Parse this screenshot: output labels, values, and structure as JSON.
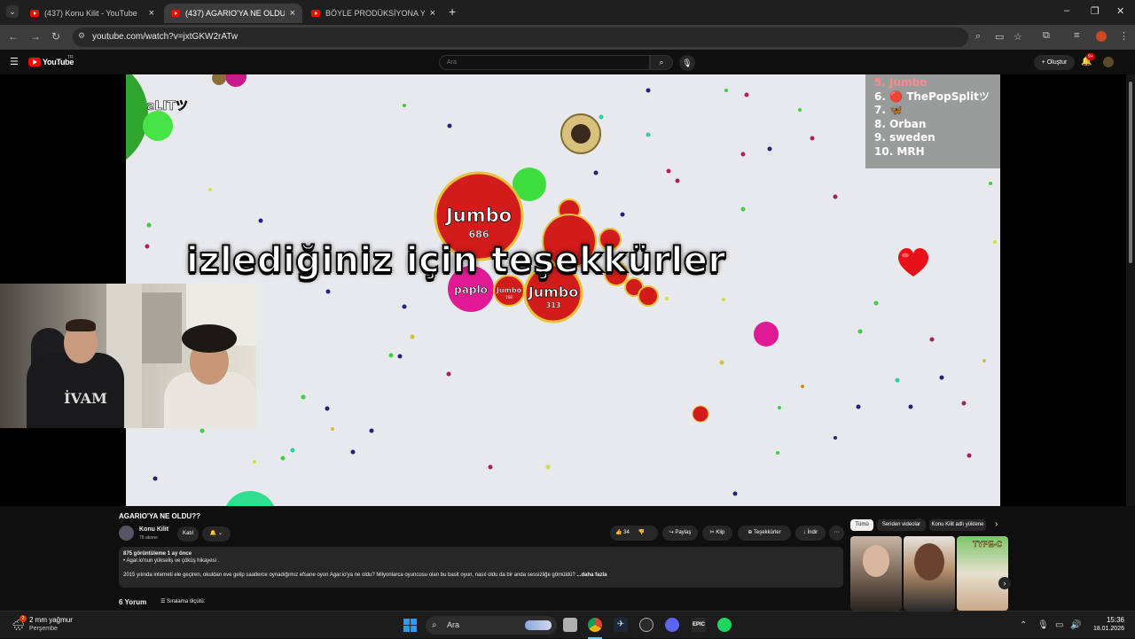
{
  "tabs": [
    {
      "title": "(437) Konu Kilit - YouTube",
      "active": false
    },
    {
      "title": "(437) AGARIO'YA NE OLDU?? -",
      "active": true
    },
    {
      "title": "BÖYLE PRODÜKSİYONA YAPILA",
      "active": false
    }
  ],
  "address": {
    "url": "youtube.com/watch?v=jxtGKW2rATw"
  },
  "youtube": {
    "logo_text": "YouTube",
    "logo_region": "TR",
    "search_placeholder": "Ara",
    "create_label": "Oluştur",
    "notif_count": "9+"
  },
  "video": {
    "thanks_text": "izlediğiniz için teşekkürler",
    "leaderboard": [
      "5. Jumbo",
      "6. 🔴 ThePopSplitツ",
      "7. 🦋",
      "8. Orban",
      "9. sweden",
      "10. MRH"
    ],
    "cells": {
      "big_name": "Jumbo",
      "big_mass": "686",
      "mid_name": "Jumbo",
      "mid_mass": "313",
      "paplo": "paplo",
      "small_jumbo": "Jumbo",
      "small_mass": "168"
    },
    "topleft_text": "ƨLITツ"
  },
  "info": {
    "title": "AGARIO'YA NE OLDU??",
    "channel": "Konu Kilit",
    "subs": "78 abone",
    "join": "Katıl",
    "likes": "34",
    "share": "Paylaş",
    "clip": "Klip",
    "thanks": "Teşekkürler",
    "download": "İndir",
    "views_line": "875 görüntüleme  1 ay önce",
    "bullet": "Agar.io'nun yükseliş ve çöküş hikayesi .",
    "desc_line": "2015 yılında interneti ele geçiren, okuldan eve gelip saatlerce oynadığımız efsane oyun Agar.io'ya ne oldu? Milyonlarca oyuncusu olan bu basit oyun, nasıl oldu da bir anda sessizliğe gömüldü?",
    "more": "...daha fazla",
    "comments": "6 Yorum",
    "sort": "Sıralama ölçütü:"
  },
  "chips": [
    "Tümü",
    "Seriden videolar",
    "Konu Kilit adlı yüklene"
  ],
  "taskbar": {
    "weather_temp": "2 mm yağmur",
    "weather_day": "Perşembe",
    "search_label": "Ara",
    "time": "15:36",
    "date": "18.01.2026"
  },
  "colors": {
    "accent_red": "#ff0000",
    "cell_red": "#d21b1b",
    "cell_green": "#3fde3f",
    "cell_magenta": "#e01a94"
  }
}
